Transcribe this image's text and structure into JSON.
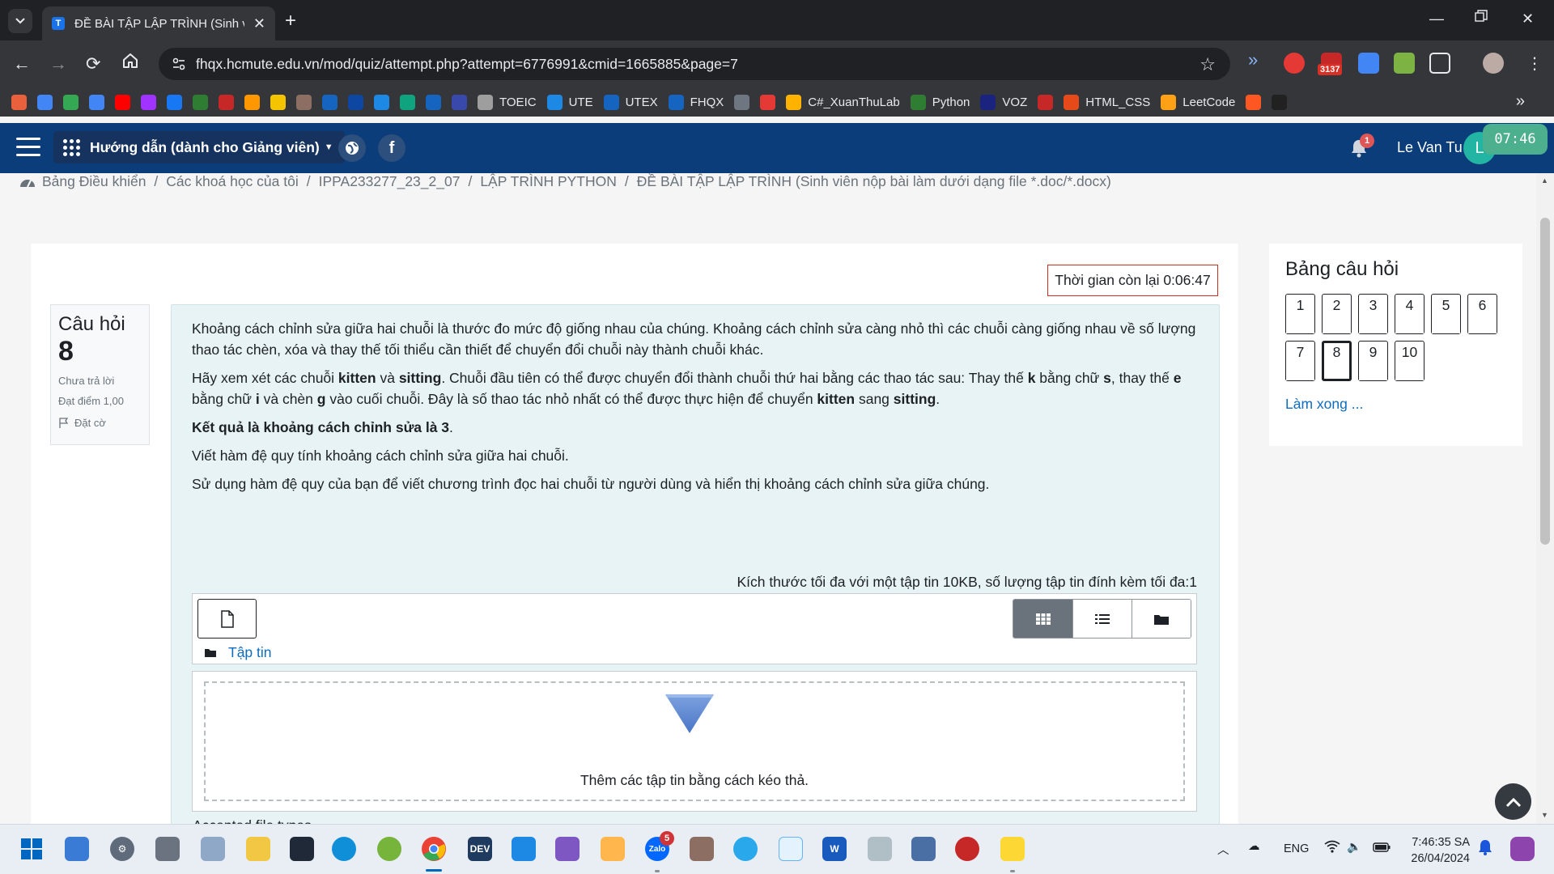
{
  "browser": {
    "tab_title": "ĐỀ BÀI TẬP LẬP TRÌNH (Sinh viên nộp bài làm dưới dạng file *.doc/*.docx)",
    "tab_favicon_letter": "T",
    "url": "fhqx.hcmute.edu.vn/mod/quiz/attempt.php?attempt=6776991&cmid=1665885&page=7",
    "extension_badge": "3137"
  },
  "bookmarks": [
    {
      "label": "",
      "color": "#e8603c",
      "icon": "grid-icon"
    },
    {
      "label": "",
      "color": "#4285f4",
      "icon": "photos-icon"
    },
    {
      "label": "",
      "color": "#34a853",
      "icon": "meet-icon"
    },
    {
      "label": "",
      "color": "#4285f4",
      "icon": "translate-icon"
    },
    {
      "label": "",
      "color": "#ff0000",
      "icon": "youtube-icon"
    },
    {
      "label": "",
      "color": "#a033ff",
      "icon": "messenger-icon"
    },
    {
      "label": "",
      "color": "#1877f2",
      "icon": "facebook-icon"
    },
    {
      "label": "",
      "color": "#2e7d32",
      "icon": "leaf-icon"
    },
    {
      "label": "",
      "color": "#c62828",
      "icon": "film-icon"
    },
    {
      "label": "",
      "color": "#ff9800",
      "icon": "hand-icon"
    },
    {
      "label": "",
      "color": "#f5c400",
      "icon": "notion-n-icon"
    },
    {
      "label": "",
      "color": "#8d6e63",
      "icon": "book-icon"
    },
    {
      "label": "",
      "color": "#1565c0",
      "icon": "calendar-icon"
    },
    {
      "label": "",
      "color": "#0d47a1",
      "icon": "allo-icon"
    },
    {
      "label": "",
      "color": "#1e88e5",
      "icon": "gemini-icon"
    },
    {
      "label": "",
      "color": "#10a37f",
      "icon": "chatgpt-icon"
    },
    {
      "label": "",
      "color": "#1565c0",
      "icon": "k-icon"
    },
    {
      "label": "",
      "color": "#3949ab",
      "icon": "q-icon"
    },
    {
      "label": "TOEIC",
      "color": "#9e9e9e",
      "icon": "globe-icon"
    },
    {
      "label": "UTE",
      "color": "#1e88e5",
      "icon": "ute-icon"
    },
    {
      "label": "UTEX",
      "color": "#1565c0",
      "icon": "t-icon"
    },
    {
      "label": "FHQX",
      "color": "#1565c0",
      "icon": "t-icon"
    },
    {
      "label": "",
      "color": "#6e7681",
      "icon": "github-icon"
    },
    {
      "label": "",
      "color": "#e53935",
      "icon": "i3-icon"
    },
    {
      "label": "C#_XuanThuLab",
      "color": "#ffb300",
      "icon": "curve-icon"
    },
    {
      "label": "Python",
      "color": "#2e7d32",
      "icon": "w3-icon"
    },
    {
      "label": "VOZ",
      "color": "#1a237e",
      "icon": "voz-icon"
    },
    {
      "label": "",
      "color": "#c62828",
      "icon": "shield-icon"
    },
    {
      "label": "HTML_CSS",
      "color": "#e64a19",
      "icon": "f8-icon"
    },
    {
      "label": "LeetCode",
      "color": "#ffa116",
      "icon": "leetcode-icon"
    },
    {
      "label": "",
      "color": "#ff5722",
      "icon": "b-icon"
    },
    {
      "label": "",
      "color": "#212121",
      "icon": "hi-icon"
    }
  ],
  "navbar": {
    "guide_label": "Hướng dẫn (dành cho Giảng viên)",
    "notification_count": "1",
    "username": "Le Van Tu",
    "avatar_letter": "L",
    "clock_widget": "07:46"
  },
  "breadcrumb": [
    "Bảng Điều khiển",
    "Các khoá học của tôi",
    "IPPA233277_23_2_07",
    "LẬP TRÌNH PYTHON",
    "ĐỀ BÀI TẬP LẬP TRÌNH (Sinh viên nộp bài làm dưới dạng file *.doc/*.docx)"
  ],
  "timer": "Thời gian còn lại 0:06:47",
  "question_info": {
    "title": "Câu hỏi",
    "number": "8",
    "status": "Chưa trả lời",
    "grade": "Đạt điểm 1,00",
    "flag_label": "Đặt cờ"
  },
  "question": {
    "p1": "Khoảng cách chỉnh sửa giữa hai chuỗi là thước đo mức độ giống nhau của chúng. Khoảng cách chỉnh sửa càng nhỏ thì các chuỗi càng giống nhau về số lượng thao tác chèn, xóa và thay thế tối thiểu cần thiết để chuyển đổi chuỗi này thành chuỗi khác.",
    "p2": [
      {
        "text": "Hãy xem xét các chuỗi ",
        "bold": false
      },
      {
        "text": "kitten",
        "bold": true
      },
      {
        "text": " và ",
        "bold": false
      },
      {
        "text": "sitting",
        "bold": true
      },
      {
        "text": ". Chuỗi đầu tiên có thể được chuyển đổi thành chuỗi thứ hai bằng các thao tác sau: Thay thế ",
        "bold": false
      },
      {
        "text": "k",
        "bold": true
      },
      {
        "text": " bằng chữ ",
        "bold": false
      },
      {
        "text": "s",
        "bold": true
      },
      {
        "text": ", thay thế ",
        "bold": false
      },
      {
        "text": "e",
        "bold": true
      },
      {
        "text": " bằng chữ ",
        "bold": false
      },
      {
        "text": "i",
        "bold": true
      },
      {
        "text": " và chèn ",
        "bold": false
      },
      {
        "text": "g",
        "bold": true
      },
      {
        "text": " vào cuối chuỗi. Đây là số thao tác nhỏ nhất có thể được thực hiện để chuyển ",
        "bold": false
      },
      {
        "text": "kitten",
        "bold": true
      },
      {
        "text": " sang ",
        "bold": false
      },
      {
        "text": "sitting",
        "bold": true
      },
      {
        "text": ".",
        "bold": false
      }
    ],
    "p3_bold": "Kết quả là khoảng cách chỉnh sửa là 3",
    "p3_tail": ".",
    "p4": "Viết hàm đệ quy tính khoảng cách chỉnh sửa giữa hai chuỗi.",
    "p5": "Sử dụng hàm đệ quy của bạn để viết chương trình đọc hai chuỗi từ người dùng và hiển thị khoảng cách chỉnh sửa giữa chúng."
  },
  "filemanager": {
    "max_size_note": "Kích thước tối đa với một tập tin 10KB, số lượng tập tin đính kèm tối đa:1",
    "path_label": "Tập tin",
    "drop_text": "Thêm các tập tin bằng cách kéo thả.",
    "accepted_label": "Accepted file types"
  },
  "quiz_nav": {
    "title": "Bảng câu hỏi",
    "questions": [
      "1",
      "2",
      "3",
      "4",
      "5",
      "6",
      "7",
      "8",
      "9",
      "10"
    ],
    "current": "8",
    "finish_label": "Làm xong ..."
  },
  "taskbar": {
    "chat_badge": "5",
    "language": "ENG",
    "time": "7:46:35 SA",
    "date": "26/04/2024"
  }
}
